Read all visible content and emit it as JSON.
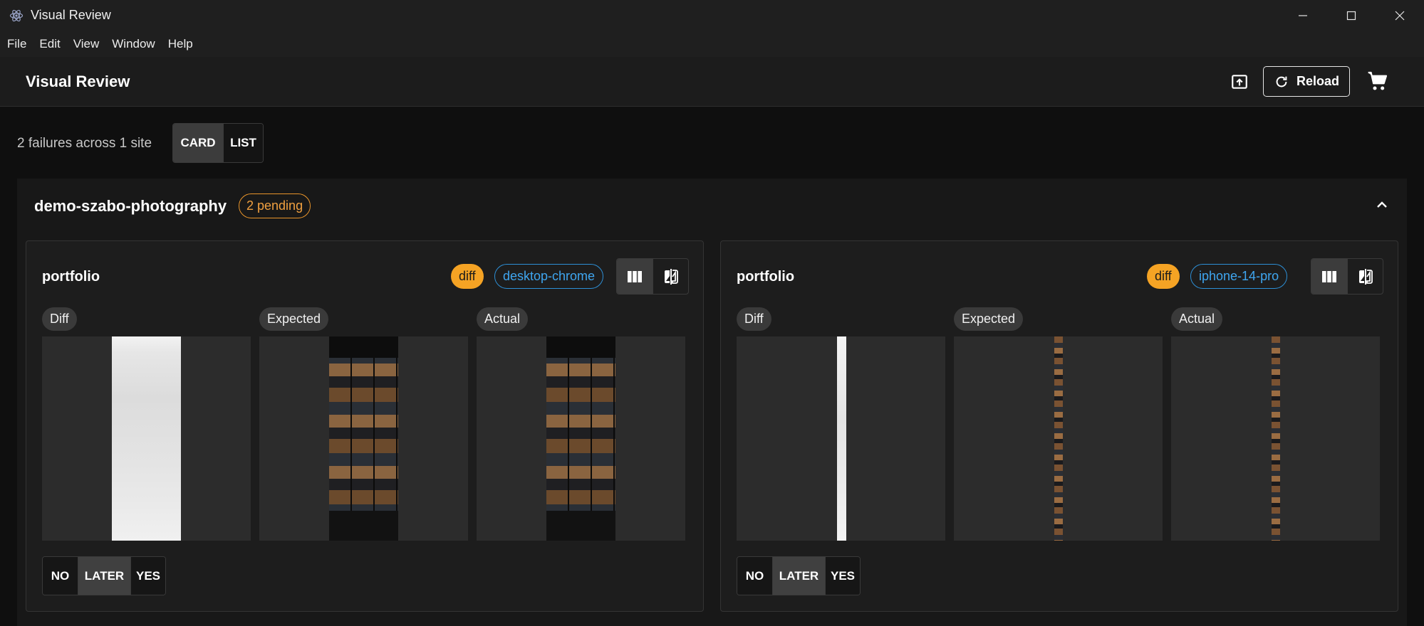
{
  "window": {
    "title": "Visual Review",
    "icons": {
      "app": "electron-atom-icon",
      "minimize": "minimize-icon",
      "maximize": "maximize-icon",
      "close": "close-icon"
    }
  },
  "menu": [
    "File",
    "Edit",
    "View",
    "Window",
    "Help"
  ],
  "header": {
    "title": "Visual Review",
    "open_icon": "open-external-icon",
    "reload_label": "Reload",
    "reload_icon": "refresh-icon",
    "cart_icon": "cart-icon"
  },
  "toolbar": {
    "summary": "2 failures across 1 site",
    "view_modes": [
      "CARD",
      "LIST"
    ],
    "active_view": "CARD"
  },
  "site": {
    "name": "demo-szabo-photography",
    "pending": "2 pending",
    "collapse_icon": "chevron-up-icon",
    "cards": [
      {
        "title": "portfolio",
        "status": "diff",
        "device": "desktop-chrome",
        "layout_icons": [
          "columns-icon",
          "compare-icon"
        ],
        "panels": [
          "Diff",
          "Expected",
          "Actual"
        ],
        "decisions": [
          "NO",
          "LATER",
          "YES"
        ],
        "active_decision": "LATER"
      },
      {
        "title": "portfolio",
        "status": "diff",
        "device": "iphone-14-pro",
        "layout_icons": [
          "columns-icon",
          "compare-icon"
        ],
        "panels": [
          "Diff",
          "Expected",
          "Actual"
        ],
        "decisions": [
          "NO",
          "LATER",
          "YES"
        ],
        "active_decision": "LATER"
      }
    ]
  },
  "colors": {
    "status_diff": "#f5a324",
    "device_chip": "#3fa6f0",
    "pending": "#f0a040"
  }
}
